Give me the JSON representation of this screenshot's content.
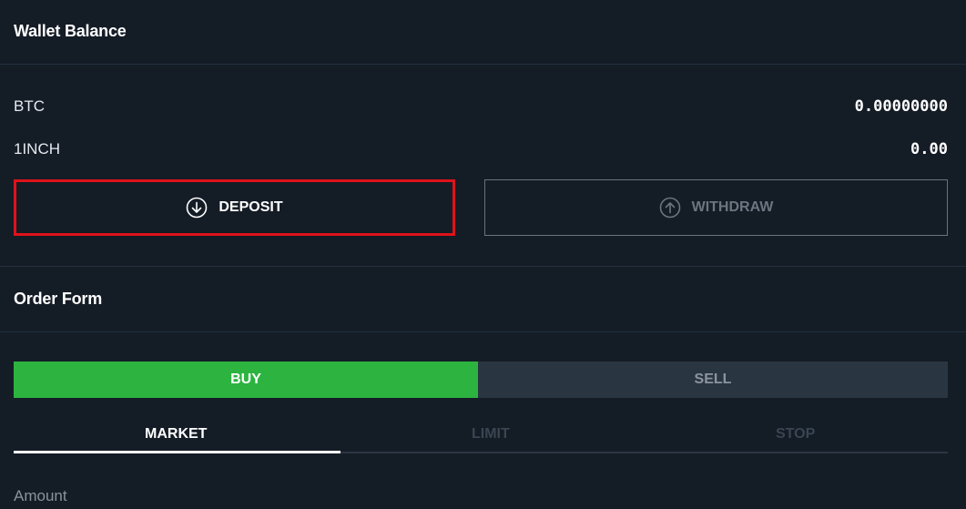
{
  "wallet": {
    "title": "Wallet Balance",
    "balances": [
      {
        "asset": "BTC",
        "amount": "0.00000000"
      },
      {
        "asset": "1INCH",
        "amount": "0.00"
      }
    ],
    "deposit_label": "DEPOSIT",
    "withdraw_label": "WITHDRAW",
    "deposit_icon": "arrow-down-circle-icon",
    "withdraw_icon": "arrow-up-circle-icon"
  },
  "order_form": {
    "title": "Order Form",
    "buy_label": "BUY",
    "sell_label": "SELL",
    "tabs": [
      {
        "label": "MARKET",
        "active": true
      },
      {
        "label": "LIMIT",
        "active": false
      },
      {
        "label": "STOP",
        "active": false
      }
    ],
    "amount_label": "Amount"
  },
  "colors": {
    "background": "#141c26",
    "buy": "#2db340",
    "sell": "#2a3542",
    "highlight": "#e0121a"
  }
}
